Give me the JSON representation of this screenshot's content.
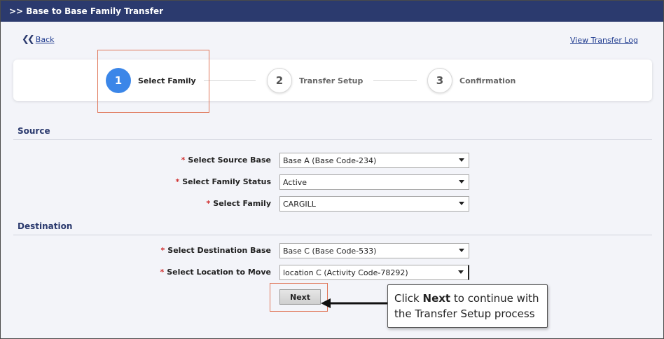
{
  "window": {
    "title": ">> Base to Base Family Transfer"
  },
  "nav": {
    "back_label": "Back",
    "back_icon": "double-chevron-left-icon",
    "log_link": "View Transfer Log"
  },
  "stepper": {
    "steps": [
      {
        "number": "1",
        "label": "Select Family",
        "state": "active"
      },
      {
        "number": "2",
        "label": "Transfer Setup",
        "state": "inactive"
      },
      {
        "number": "3",
        "label": "Confirmation",
        "state": "inactive"
      }
    ]
  },
  "source": {
    "title": "Source",
    "fields": [
      {
        "required": "*",
        "label": "Select Source Base",
        "value": "Base A (Base Code-234)"
      },
      {
        "required": "*",
        "label": "Select Family Status",
        "value": "Active"
      },
      {
        "required": "*",
        "label": "Select Family",
        "value": "CARGILL"
      }
    ]
  },
  "destination": {
    "title": "Destination",
    "fields": [
      {
        "required": "*",
        "label": "Select Destination Base",
        "value": "Base C (Base Code-533)"
      },
      {
        "required": "*",
        "label": "Select Location to Move",
        "value": "location C (Activity Code-78292)"
      }
    ]
  },
  "actions": {
    "next_label": "Next"
  },
  "callout": {
    "pre": "Click ",
    "bold": "Next",
    "post": " to continue with the Transfer Setup process"
  },
  "colors": {
    "titlebar": "#2b3a6e",
    "active_step": "#3b86e8",
    "highlight": "#e0775a",
    "required": "#d03030"
  }
}
